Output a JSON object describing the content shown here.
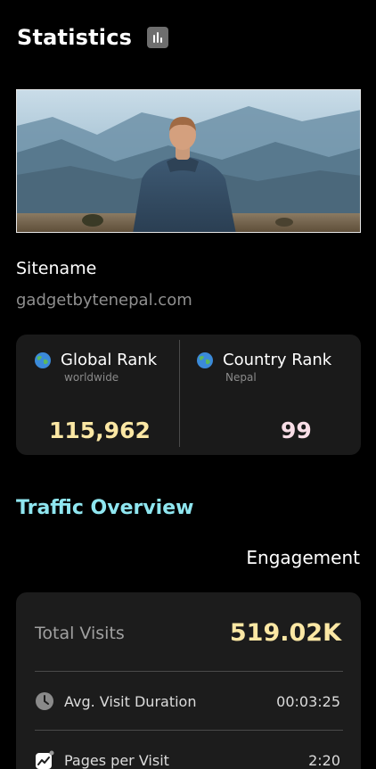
{
  "header": {
    "title": "Statistics",
    "icon": "bar-chart-icon"
  },
  "hero": {
    "image": "hero-landscape-image",
    "icon": "person-mountain-landscape"
  },
  "site": {
    "label": "Sitename",
    "url": "gadgetbytenepal.com"
  },
  "ranks": {
    "global": {
      "title": "Global Rank",
      "subtitle": "worldwide",
      "value": "115,962",
      "icon": "globe-icon"
    },
    "country": {
      "title": "Country Rank",
      "subtitle": "Nepal",
      "value": "99",
      "icon": "globe-icon"
    }
  },
  "traffic": {
    "title": "Traffic Overview",
    "engagement_label": "Engagement"
  },
  "engagement": {
    "total_visits_label": "Total Visits",
    "total_visits_value": "519.02K",
    "metrics": [
      {
        "label": "Avg. Visit Duration",
        "value": "00:03:25",
        "icon": "clock-icon"
      },
      {
        "label": "Pages per Visit",
        "value": "2:20",
        "icon": "trend-chart-icon"
      }
    ]
  },
  "colors": {
    "background": "#000000",
    "card": "#1a1a1a",
    "accent_cyan": "#8fe6f0",
    "accent_gold": "#fbe7a4",
    "accent_pink": "#f8dde6"
  }
}
